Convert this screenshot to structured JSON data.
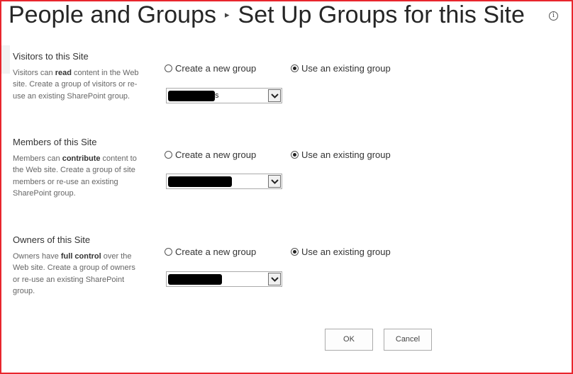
{
  "header": {
    "breadcrumb_parent": "People and Groups",
    "breadcrumb_separator": "▸",
    "page_title": "Set Up Groups for this Site",
    "info_icon_glyph": "i"
  },
  "sections": [
    {
      "title": "Visitors to this Site",
      "desc_before": "Visitors can ",
      "desc_bold": "read",
      "desc_after": " content in the Web site. Create a group of visitors or re-use an existing SharePoint group.",
      "radio_new": "Create a new group",
      "radio_existing": "Use an existing group",
      "selected_option": "existing",
      "dropdown_value": "s"
    },
    {
      "title": "Members of this Site",
      "desc_before": "Members can ",
      "desc_bold": "contribute",
      "desc_after": " content to the Web site. Create a group of site members or re-use an existing SharePoint group.",
      "radio_new": "Create a new group",
      "radio_existing": "Use an existing group",
      "selected_option": "existing",
      "dropdown_value": ""
    },
    {
      "title": "Owners of this Site",
      "desc_before": "Owners have ",
      "desc_bold": "full control",
      "desc_after": " over the Web site. Create a group of owners or re-use an existing SharePoint group.",
      "radio_new": "Create a new group",
      "radio_existing": "Use an existing group",
      "selected_option": "existing",
      "dropdown_value": ""
    }
  ],
  "buttons": {
    "ok_label": "OK",
    "cancel_label": "Cancel"
  },
  "colors": {
    "frame_border": "#e8262d",
    "title_text": "#262626",
    "description_text": "#666666"
  }
}
